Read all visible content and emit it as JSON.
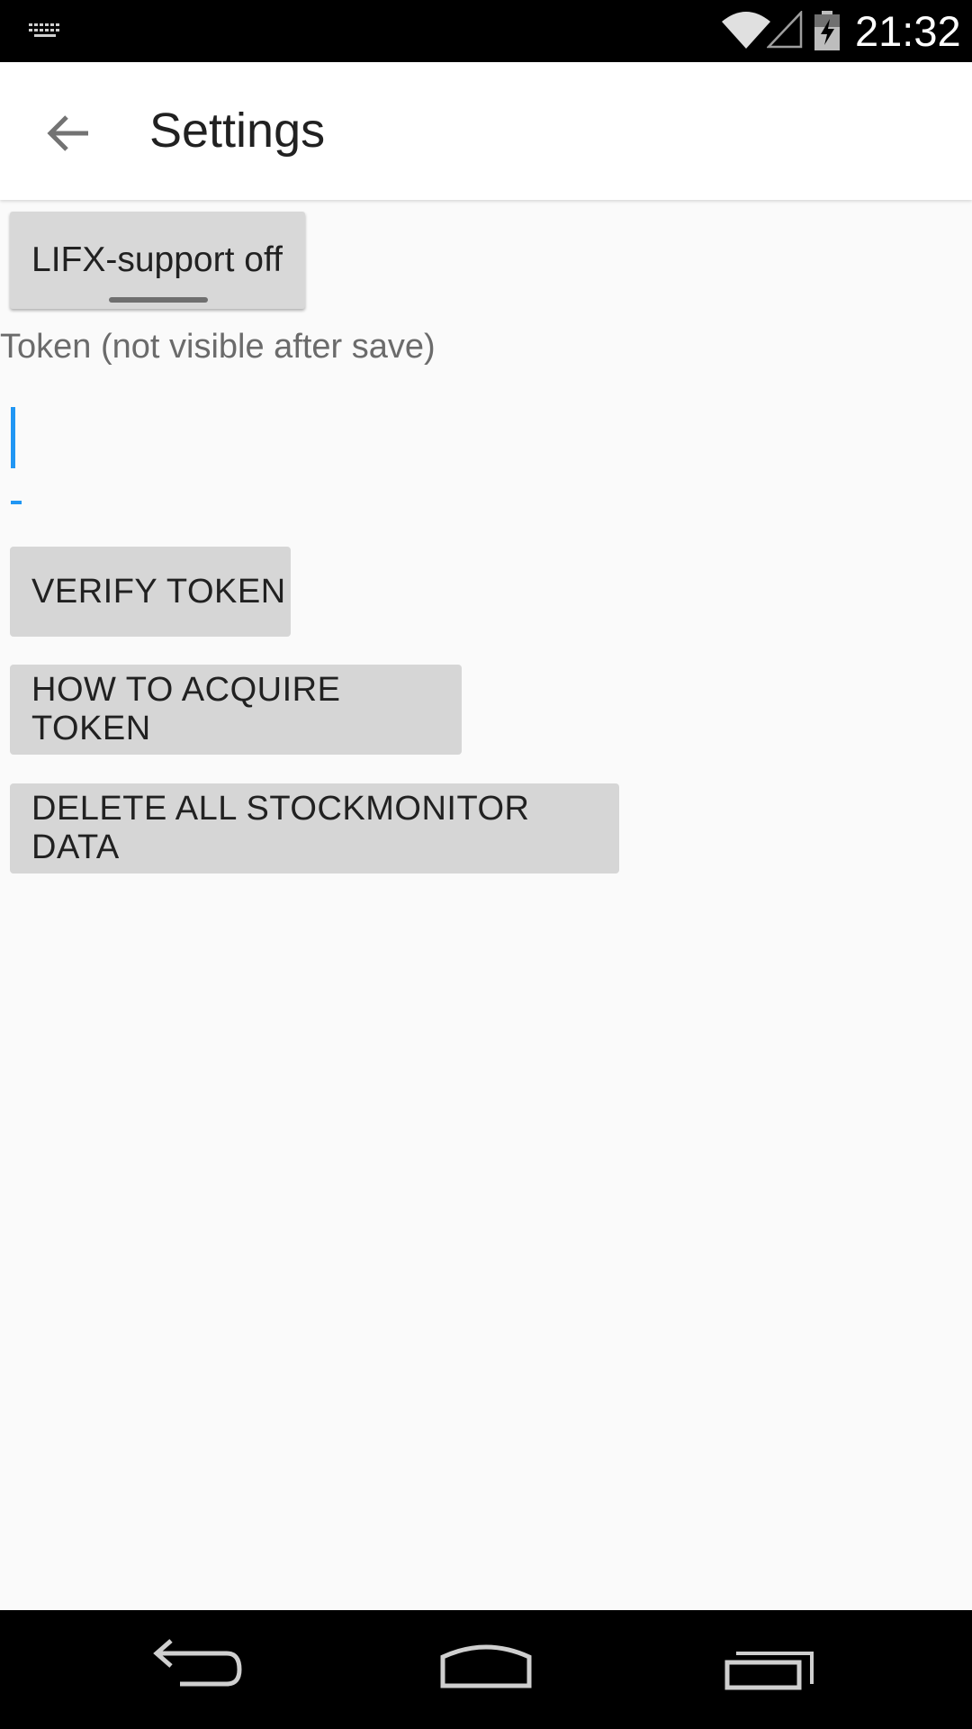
{
  "status_bar": {
    "time": "21:32",
    "icons": [
      "keyboard-icon",
      "wifi-icon",
      "signal-icon",
      "battery-charging-icon"
    ]
  },
  "app_bar": {
    "title": "Settings",
    "back_icon": "arrow-left-icon"
  },
  "settings": {
    "lifx_toggle_label": "LIFX-support off",
    "token_label": "Token (not visible after save)",
    "token_value": "",
    "verify_label": "VERIFY TOKEN",
    "acquire_label": "HOW TO ACQUIRE TOKEN",
    "delete_label": "DELETE ALL STOCKMONITOR DATA"
  },
  "nav_bar": {
    "icons": [
      "back-nav-icon",
      "home-nav-icon",
      "recents-nav-icon"
    ]
  },
  "colors": {
    "accent": "#2196f3",
    "button_bg": "#d6d6d6",
    "content_bg": "#fafafa"
  }
}
